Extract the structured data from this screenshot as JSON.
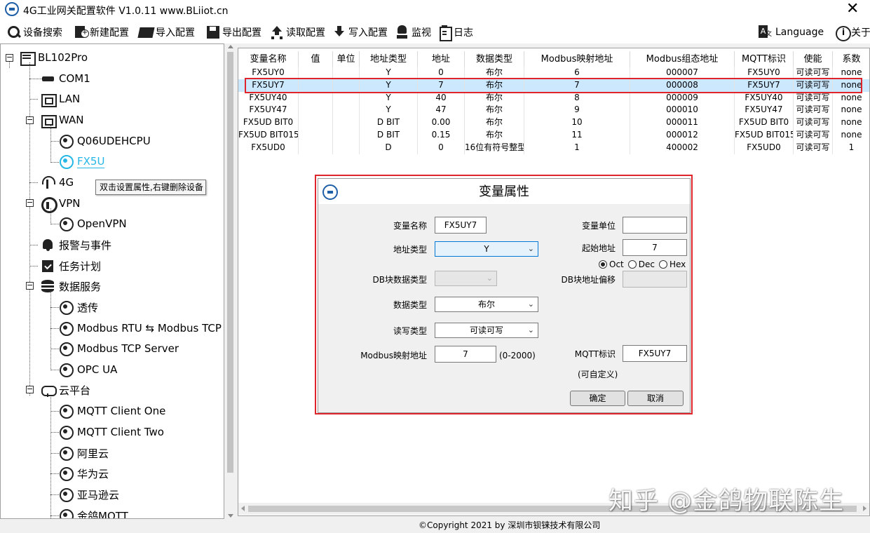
{
  "window": {
    "title": "4G工业网关配置软件 V1.0.11 www.BLiiot.cn",
    "close_glyph": "✕"
  },
  "toolbar": {
    "device_search": "设备搜索",
    "new_config": "新建配置",
    "import_config": "导入配置",
    "export_config": "导出配置",
    "read_config": "读取配置",
    "write_config": "写入配置",
    "monitor": "监视",
    "log": "日志",
    "language": "Language",
    "about": "关于"
  },
  "tree": {
    "root": "BL102Pro",
    "com1": "COM1",
    "lan": "LAN",
    "wan": "WAN",
    "wan_dev1": "Q06UDEHCPU",
    "wan_dev2": "FX5U",
    "g4": "4G",
    "vpn": "VPN",
    "openvpn": "OpenVPN",
    "alarm": "报警与事件",
    "task": "任务计划",
    "data_service": "数据服务",
    "ds_passthrough": "透传",
    "ds_rtu_tcp": "Modbus RTU ⇆ Modbus TCP",
    "ds_tcp_server": "Modbus TCP Server",
    "ds_opcua": "OPC UA",
    "cloud": "云平台",
    "cloud_mqtt1": "MQTT Client One",
    "cloud_mqtt2": "MQTT Client Two",
    "cloud_aliyun": "阿里云",
    "cloud_huawei": "华为云",
    "cloud_aws": "亚马逊云",
    "cloud_jinge": "金鸽MQTT",
    "tooltip": "双击设置属性,右键删除设备"
  },
  "table": {
    "headers": [
      "变量名称",
      "值",
      "单位",
      "地址类型",
      "地址",
      "数据类型",
      "Modbus映射地址",
      "Modbus组态地址",
      "MQTT标识",
      "使能",
      "系数"
    ],
    "rows": [
      [
        "FX5UY0",
        "",
        "",
        "Y",
        "0",
        "布尔",
        "6",
        "000007",
        "FX5UY0",
        "可读可写",
        "none"
      ],
      [
        "FX5UY7",
        "",
        "",
        "Y",
        "7",
        "布尔",
        "7",
        "000008",
        "FX5UY7",
        "可读可写",
        "none"
      ],
      [
        "FX5UY40",
        "",
        "",
        "Y",
        "40",
        "布尔",
        "8",
        "000009",
        "FX5UY40",
        "可读可写",
        "none"
      ],
      [
        "FX5UY47",
        "",
        "",
        "Y",
        "47",
        "布尔",
        "9",
        "000010",
        "FX5UY47",
        "可读可写",
        "none"
      ],
      [
        "FX5UD BIT0",
        "",
        "",
        "D BIT",
        "0.00",
        "布尔",
        "10",
        "000011",
        "FX5UD BIT0",
        "可读可写",
        "none"
      ],
      [
        "FX5UD BIT015",
        "",
        "",
        "D BIT",
        "0.15",
        "布尔",
        "11",
        "000012",
        "FX5UD BIT015",
        "可读可写",
        "none"
      ],
      [
        "FX5UD0",
        "",
        "",
        "D",
        "0",
        "16位有符号整型",
        "1",
        "400002",
        "FX5UD0",
        "可读可写",
        "1"
      ]
    ],
    "selected_row": 1
  },
  "dialog": {
    "title": "变量属性",
    "var_name_label": "变量名称",
    "var_name_value": "FX5UY7",
    "var_unit_label": "变量单位",
    "var_unit_value": "",
    "addr_type_label": "地址类型",
    "addr_type_value": "Y",
    "start_addr_label": "起始地址",
    "start_addr_value": "7",
    "radio_oct": "Oct",
    "radio_dec": "Dec",
    "radio_hex": "Hex",
    "radio_selected": "Oct",
    "db_type_label": "DB块数据类型",
    "db_type_value": "",
    "db_offset_label": "DB块地址偏移",
    "db_offset_value": "",
    "data_type_label": "数据类型",
    "data_type_value": "布尔",
    "rw_type_label": "读写类型",
    "rw_type_value": "可读可写",
    "modbus_map_label": "Modbus映射地址",
    "modbus_map_value": "7",
    "modbus_map_range": "(0-2000)",
    "mqtt_label": "MQTT标识",
    "mqtt_value": "FX5UY7",
    "mqtt_hint": "(可自定义)",
    "ok": "确定",
    "cancel": "取消"
  },
  "footer": "©Copyright 2021 by 深圳市钡铼技术有限公司",
  "watermark": "知乎 @金鸽物联陈生",
  "colors": {
    "accent": "#27b7e6",
    "selection": "#cce8ff",
    "highlight_box": "#e0242c"
  }
}
